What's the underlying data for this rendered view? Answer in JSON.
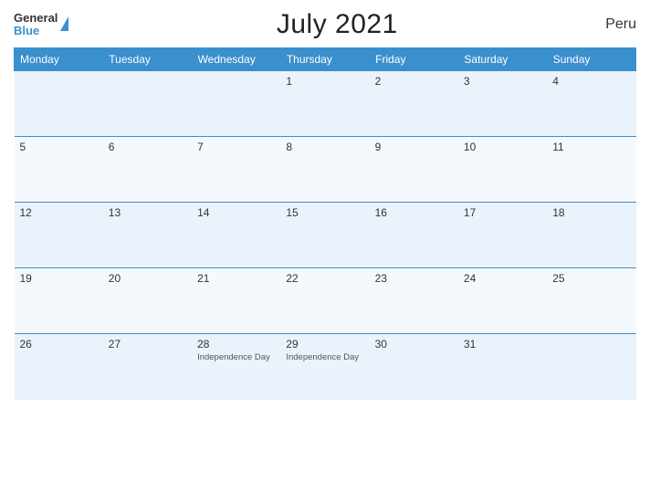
{
  "header": {
    "logo_general": "General",
    "logo_blue": "Blue",
    "title": "July 2021",
    "country": "Peru"
  },
  "days_of_week": [
    "Monday",
    "Tuesday",
    "Wednesday",
    "Thursday",
    "Friday",
    "Saturday",
    "Sunday"
  ],
  "weeks": [
    [
      {
        "day": "",
        "event": ""
      },
      {
        "day": "",
        "event": ""
      },
      {
        "day": "",
        "event": ""
      },
      {
        "day": "1",
        "event": ""
      },
      {
        "day": "2",
        "event": ""
      },
      {
        "day": "3",
        "event": ""
      },
      {
        "day": "4",
        "event": ""
      }
    ],
    [
      {
        "day": "5",
        "event": ""
      },
      {
        "day": "6",
        "event": ""
      },
      {
        "day": "7",
        "event": ""
      },
      {
        "day": "8",
        "event": ""
      },
      {
        "day": "9",
        "event": ""
      },
      {
        "day": "10",
        "event": ""
      },
      {
        "day": "11",
        "event": ""
      }
    ],
    [
      {
        "day": "12",
        "event": ""
      },
      {
        "day": "13",
        "event": ""
      },
      {
        "day": "14",
        "event": ""
      },
      {
        "day": "15",
        "event": ""
      },
      {
        "day": "16",
        "event": ""
      },
      {
        "day": "17",
        "event": ""
      },
      {
        "day": "18",
        "event": ""
      }
    ],
    [
      {
        "day": "19",
        "event": ""
      },
      {
        "day": "20",
        "event": ""
      },
      {
        "day": "21",
        "event": ""
      },
      {
        "day": "22",
        "event": ""
      },
      {
        "day": "23",
        "event": ""
      },
      {
        "day": "24",
        "event": ""
      },
      {
        "day": "25",
        "event": ""
      }
    ],
    [
      {
        "day": "26",
        "event": ""
      },
      {
        "day": "27",
        "event": ""
      },
      {
        "day": "28",
        "event": "Independence Day"
      },
      {
        "day": "29",
        "event": "Independence Day"
      },
      {
        "day": "30",
        "event": ""
      },
      {
        "day": "31",
        "event": ""
      },
      {
        "day": "",
        "event": ""
      }
    ]
  ]
}
